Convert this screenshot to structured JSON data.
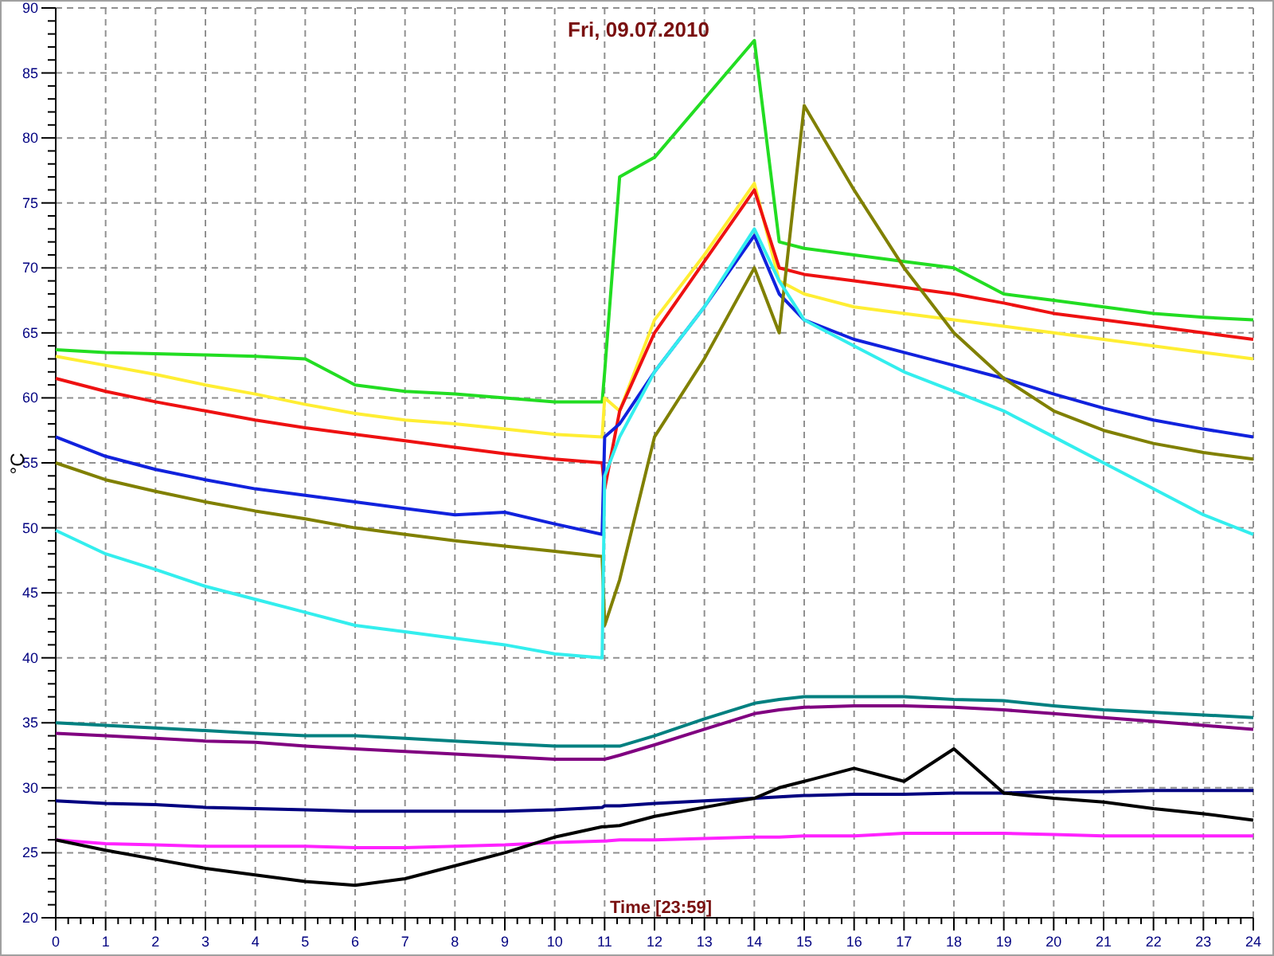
{
  "chart": {
    "chart_data": {
      "type": "line",
      "title": "Fri, 09.07.2010",
      "xlabel": "Time [23:59]",
      "ylabel": "°C",
      "x": [
        0,
        1,
        2,
        3,
        4,
        5,
        6,
        7,
        8,
        9,
        10,
        10.95,
        11,
        11.3,
        12,
        13,
        14,
        14.5,
        15,
        16,
        17,
        18,
        19,
        20,
        21,
        22,
        23,
        24
      ],
      "series": [
        {
          "color": "#22dd22",
          "values": [
            63.7,
            63.5,
            63.4,
            63.3,
            63.2,
            63,
            61,
            60.5,
            60.3,
            60,
            59.7,
            59.7,
            62,
            77,
            78.5,
            83,
            87.5,
            72,
            71.5,
            71,
            70.5,
            70,
            68,
            67.5,
            67,
            66.5,
            66.2,
            66
          ]
        },
        {
          "color": "#ffee33",
          "values": [
            63.2,
            62.5,
            61.8,
            61,
            60.3,
            59.5,
            58.8,
            58.3,
            58,
            57.6,
            57.2,
            57,
            60,
            59,
            66,
            71,
            76.5,
            69,
            68,
            67,
            66.5,
            66,
            65.5,
            65,
            64.5,
            64,
            63.5,
            63
          ]
        },
        {
          "color": "#ee1111",
          "values": [
            61.5,
            60.5,
            59.7,
            59,
            58.3,
            57.7,
            57.2,
            56.7,
            56.2,
            55.7,
            55.3,
            55,
            53,
            59,
            65,
            70.5,
            76,
            70,
            69.5,
            69,
            68.5,
            68,
            67.3,
            66.5,
            66,
            65.5,
            65,
            64.5
          ]
        },
        {
          "color": "#1122dd",
          "values": [
            57,
            55.5,
            54.5,
            53.7,
            53,
            52.5,
            52,
            51.5,
            51,
            51.2,
            50.3,
            49.5,
            57,
            58,
            62,
            67,
            72.5,
            68,
            66,
            64.5,
            63.5,
            62.5,
            61.5,
            60.3,
            59.2,
            58.3,
            57.6,
            57
          ]
        },
        {
          "color": "#808000",
          "values": [
            55,
            53.7,
            52.8,
            52,
            51.3,
            50.7,
            50,
            49.5,
            49,
            48.6,
            48.2,
            47.8,
            42.5,
            46,
            57,
            63,
            70,
            65,
            82.5,
            76,
            70,
            65,
            61.5,
            59,
            57.5,
            56.5,
            55.8,
            55.3
          ]
        },
        {
          "color": "#33eeee",
          "values": [
            49.8,
            48,
            46.8,
            45.5,
            44.5,
            43.5,
            42.5,
            42,
            41.5,
            41,
            40.3,
            40,
            54,
            57,
            62,
            67,
            73,
            69,
            66,
            64,
            62,
            60.5,
            59,
            57,
            55,
            53,
            51,
            49.5
          ]
        },
        {
          "color": "#008080",
          "values": [
            35,
            34.8,
            34.6,
            34.4,
            34.2,
            34,
            34,
            33.8,
            33.6,
            33.4,
            33.2,
            33.2,
            33.2,
            33.2,
            34,
            35.3,
            36.5,
            36.8,
            37,
            37,
            37,
            36.8,
            36.7,
            36.3,
            36,
            35.8,
            35.6,
            35.4
          ]
        },
        {
          "color": "#800080",
          "values": [
            34.2,
            34,
            33.8,
            33.6,
            33.5,
            33.2,
            33,
            32.8,
            32.6,
            32.4,
            32.2,
            32.2,
            32.2,
            32.5,
            33.3,
            34.5,
            35.7,
            36,
            36.2,
            36.3,
            36.3,
            36.2,
            36,
            35.7,
            35.4,
            35.1,
            34.8,
            34.5
          ]
        },
        {
          "color": "#000080",
          "values": [
            29,
            28.8,
            28.7,
            28.5,
            28.4,
            28.3,
            28.2,
            28.2,
            28.2,
            28.2,
            28.3,
            28.5,
            28.6,
            28.6,
            28.8,
            29,
            29.2,
            29.3,
            29.4,
            29.5,
            29.5,
            29.6,
            29.6,
            29.7,
            29.7,
            29.8,
            29.8,
            29.8
          ]
        },
        {
          "color": "#ff22ff",
          "values": [
            26,
            25.7,
            25.6,
            25.5,
            25.5,
            25.5,
            25.4,
            25.4,
            25.5,
            25.6,
            25.8,
            25.9,
            25.9,
            26,
            26,
            26.1,
            26.2,
            26.2,
            26.3,
            26.3,
            26.5,
            26.5,
            26.5,
            26.4,
            26.3,
            26.3,
            26.3,
            26.3
          ]
        },
        {
          "color": "#000000",
          "values": [
            26,
            25.2,
            24.5,
            23.8,
            23.3,
            22.8,
            22.5,
            23,
            24,
            25,
            26.2,
            27,
            27,
            27.1,
            27.8,
            28.5,
            29.2,
            30,
            30.5,
            31.5,
            30.5,
            33,
            29.6,
            29.2,
            28.9,
            28.4,
            28,
            27.5
          ]
        }
      ],
      "grid": true,
      "xlim": [
        0,
        24
      ],
      "ylim": [
        20,
        90
      ],
      "xticks": [
        0,
        1,
        2,
        3,
        4,
        5,
        6,
        7,
        8,
        9,
        10,
        11,
        12,
        13,
        14,
        15,
        16,
        17,
        18,
        19,
        20,
        21,
        22,
        23,
        24
      ],
      "yticks": [
        20,
        25,
        30,
        35,
        40,
        45,
        50,
        55,
        60,
        65,
        70,
        75,
        80,
        85,
        90
      ]
    }
  }
}
